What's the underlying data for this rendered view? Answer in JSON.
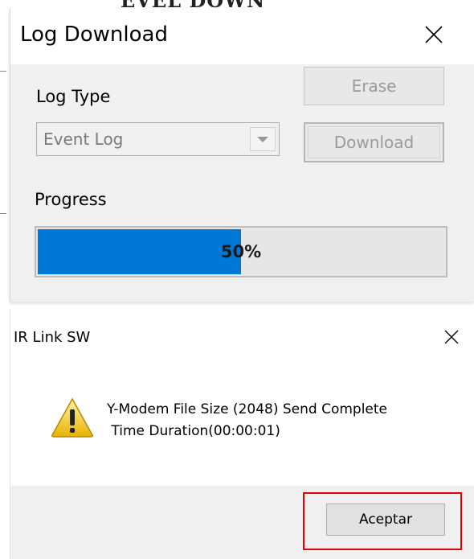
{
  "colors": {
    "progress_fill": "#0078d7",
    "dialog_client": "#f0f0f0",
    "highlight": "#e00000"
  },
  "log_download": {
    "title": "Log Download",
    "log_type_label": "Log Type",
    "log_type_value": "Event Log",
    "erase_label": "Erase",
    "download_label": "Download",
    "progress_label": "Progress",
    "progress_text": "50%",
    "progress_fraction": 0.5,
    "close_icon": "close-icon"
  },
  "message_box": {
    "title": "IR Link SW",
    "icon": "warning-icon",
    "message_line1": "Y-Modem File Size (2048) Send Complete",
    "message_line2": " Time Duration(00:00:01)",
    "ok_label": "Aceptar",
    "close_icon": "close-icon"
  }
}
